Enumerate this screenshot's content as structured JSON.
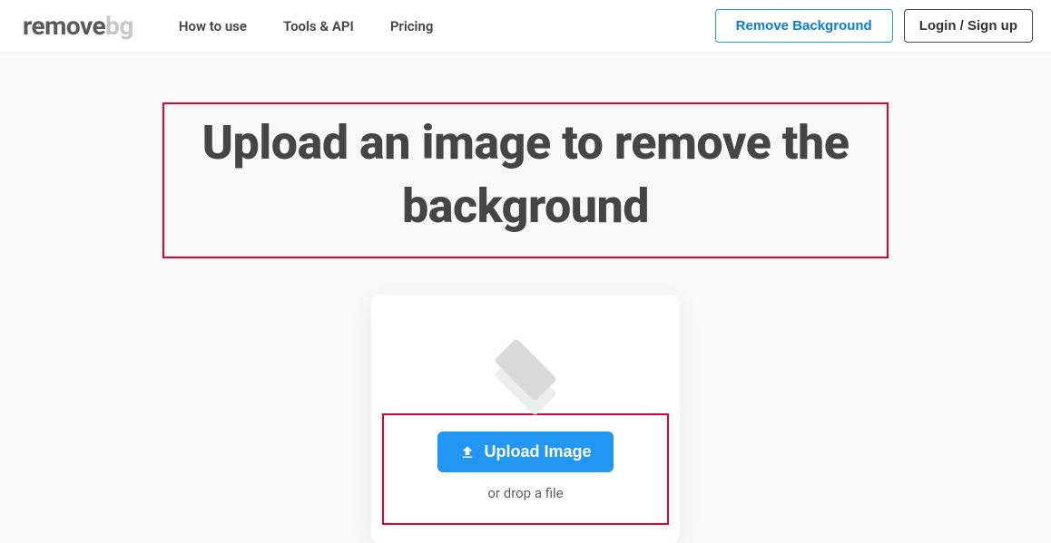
{
  "logo": {
    "part1": "remove",
    "part2": "bg"
  },
  "nav": {
    "howto": "How to use",
    "tools": "Tools & API",
    "pricing": "Pricing"
  },
  "header": {
    "remove_bg": "Remove Background",
    "login": "Login / Sign up"
  },
  "main": {
    "headline": "Upload an image to remove the background",
    "upload_button": "Upload Image",
    "drop_hint": "or drop a file"
  }
}
